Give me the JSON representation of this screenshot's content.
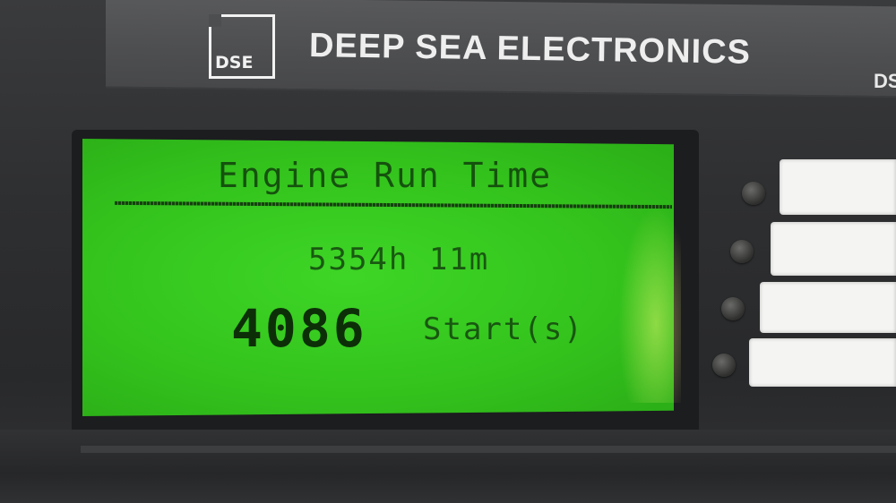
{
  "device": {
    "brand_text": "DEEP SEA ELECTRONICS",
    "logo_text": "DSE",
    "model_tag": "DS"
  },
  "lcd": {
    "title": "Engine Run Time",
    "run_time": "5354h 11m",
    "starts_count": "4086",
    "starts_label": "Start(s)",
    "backlight_color": "#35c81e",
    "text_color": "#0f3a0b"
  },
  "side_buttons": [
    {
      "icon": "round-softkey"
    },
    {
      "icon": "round-softkey"
    },
    {
      "icon": "round-softkey"
    },
    {
      "icon": "round-softkey"
    }
  ]
}
